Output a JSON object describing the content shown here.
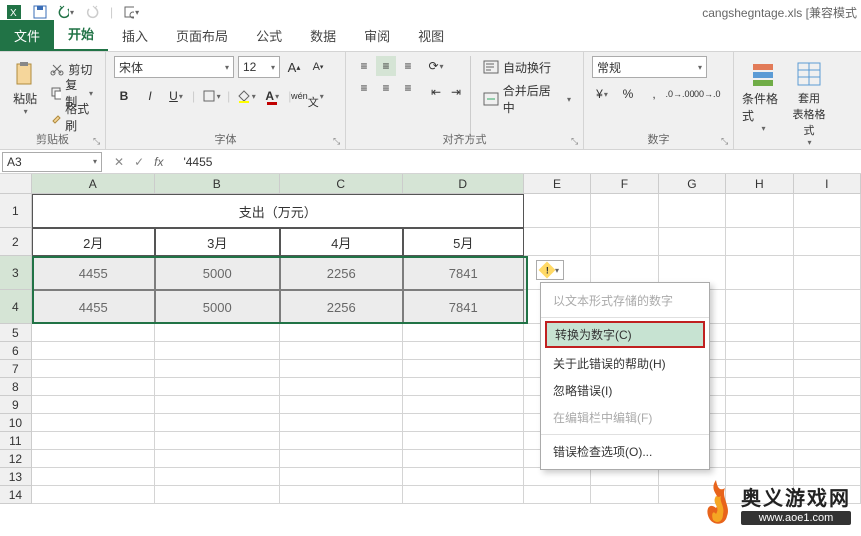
{
  "title": {
    "filename": "cangshegntage.xls",
    "mode": "[兼容模式"
  },
  "tabs": {
    "file": "文件",
    "home": "开始",
    "insert": "插入",
    "layout": "页面布局",
    "formula": "公式",
    "data": "数据",
    "review": "审阅",
    "view": "视图"
  },
  "ribbon": {
    "clipboard": {
      "paste": "粘贴",
      "cut": "剪切",
      "copy": "复制",
      "painter": "格式刷",
      "label": "剪贴板"
    },
    "font": {
      "name": "宋体",
      "size": "12",
      "label": "字体"
    },
    "align": {
      "wrap": "自动换行",
      "merge": "合并后居中",
      "label": "对齐方式"
    },
    "number": {
      "format": "常规",
      "label": "数字"
    },
    "styles": {
      "cond": "条件格式",
      "table": "套用\n表格格式"
    }
  },
  "namebox": {
    "ref": "A3",
    "formula": "'4455"
  },
  "cols": [
    "A",
    "B",
    "C",
    "D",
    "E",
    "F",
    "G",
    "H",
    "I"
  ],
  "rows": [
    "1",
    "2",
    "3",
    "4",
    "5",
    "6",
    "7",
    "8",
    "9",
    "10",
    "11",
    "12",
    "13",
    "14"
  ],
  "grid": {
    "title": "支出（万元）",
    "headers": [
      "2月",
      "3月",
      "4月",
      "5月"
    ],
    "r3": [
      "4455",
      "5000",
      "2256",
      "7841"
    ],
    "r4": [
      "4455",
      "5000",
      "2256",
      "7841"
    ]
  },
  "menu": {
    "title": "以文本形式存储的数字",
    "convert": "转换为数字(C)",
    "help": "关于此错误的帮助(H)",
    "ignore": "忽略错误(I)",
    "edit": "在编辑栏中编辑(F)",
    "options": "错误检查选项(O)..."
  },
  "watermark": {
    "cn": "奥义游戏网",
    "url": "www.aoe1.com"
  },
  "chart_data": {
    "type": "table",
    "title": "支出（万元）",
    "categories": [
      "2月",
      "3月",
      "4月",
      "5月"
    ],
    "series": [
      {
        "name": "row3",
        "values": [
          4455,
          5000,
          2256,
          7841
        ]
      },
      {
        "name": "row4",
        "values": [
          4455,
          5000,
          2256,
          7841
        ]
      }
    ]
  }
}
